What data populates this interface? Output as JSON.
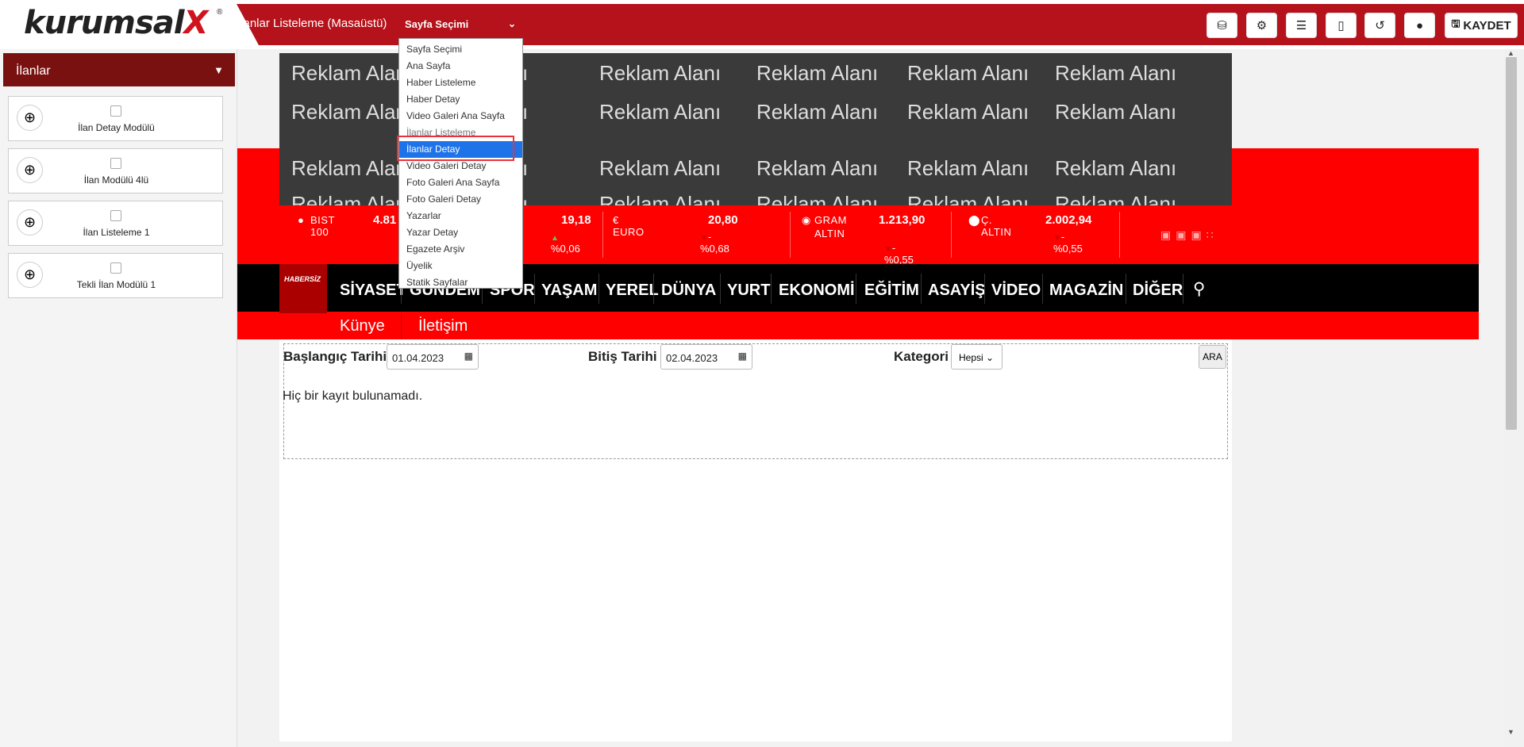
{
  "app": {
    "logo_text": "kurumsal",
    "logo_x": "X",
    "logo_reg": "®",
    "page_title": "İlanlar Listeleme (Masaüstü)",
    "page_select_value": "Sayfa Seçimi"
  },
  "toolbar": {
    "save_label": "KAYDET",
    "icons": [
      "cubes-icon",
      "gear-icon",
      "list-icon",
      "mobile-icon",
      "undo-icon",
      "globe-icon",
      "save-icon"
    ]
  },
  "dropdown": {
    "options": [
      "Sayfa Seçimi",
      "Ana Sayfa",
      "Haber Listeleme",
      "Haber Detay",
      "Video Galeri Ana Sayfa",
      "İlanlar Listeleme",
      "İlanlar Detay",
      "Video Galeri Detay",
      "Foto Galeri Ana Sayfa",
      "Foto Galeri Detay",
      "Yazarlar",
      "Yazar Detay",
      "Egazete Arşiv",
      "Üyelik",
      "Statik Sayfalar"
    ],
    "selected": "İlanlar Detay"
  },
  "sidebar": {
    "title": "İlanlar",
    "modules": [
      {
        "label": "İlan Detay Modülü"
      },
      {
        "label": "İlan Modülü 4lü"
      },
      {
        "label": "İlan Listeleme 1"
      },
      {
        "label": "Tekli İlan Modülü 1"
      }
    ]
  },
  "ads": {
    "text": "Reklam Alanı"
  },
  "ticker": {
    "bist": {
      "name": "BIST 100",
      "value": "4.81",
      "change": "-("
    },
    "dolar": {
      "value": "19,18",
      "change": "%0,06"
    },
    "euro": {
      "name": "€ EURO",
      "value": "20,80",
      "change": "-%0,68"
    },
    "gram": {
      "name1": "GRAM",
      "name2": "ALTIN",
      "value": "1.213,90",
      "change": "-%0,55"
    },
    "ceyrek": {
      "name": "Ç. ALTIN",
      "value": "2.002,94",
      "change": "-%0,55"
    }
  },
  "site": {
    "logo": "HABERSİZ"
  },
  "nav": {
    "items": [
      "SİYASET",
      "GÜNDEM",
      "SPOR",
      "YAŞAM",
      "YEREL",
      "DÜNYA",
      "YURT",
      "EKONOMİ",
      "EĞİTİM",
      "ASAYİŞ",
      "VİDEO",
      "MAGAZİN",
      "DİĞER"
    ],
    "sub": [
      "Künye",
      "İletişim"
    ]
  },
  "filter": {
    "start_label": "Başlangıç Tarihi",
    "start_value": "01.04.2023",
    "end_label": "Bitiş Tarihi",
    "end_value": "02.04.2023",
    "category_label": "Kategori",
    "category_value": "Hepsi",
    "search_button": "ARA",
    "empty_message": "Hiç bir kayıt bulunamadı."
  }
}
